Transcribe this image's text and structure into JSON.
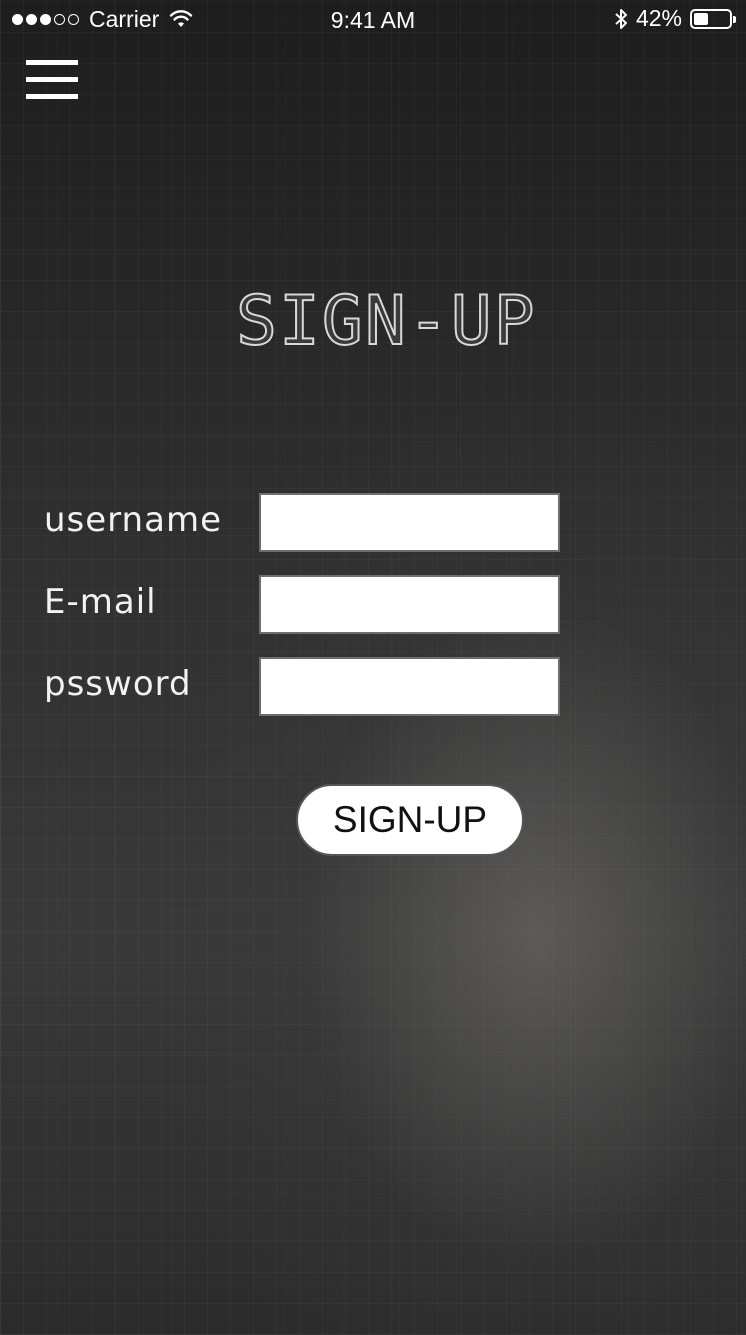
{
  "status_bar": {
    "carrier": "Carrier",
    "time": "9:41 AM",
    "battery_percent_text": "42%",
    "battery_level": 0.42,
    "signal_bars_filled": 3,
    "signal_bars_total": 5
  },
  "header": {
    "menu_icon": "hamburger-menu-icon"
  },
  "main": {
    "title": "SIGN-UP",
    "fields": [
      {
        "label": "username",
        "value": ""
      },
      {
        "label": "E-mail",
        "value": ""
      },
      {
        "label": "pssword",
        "value": ""
      }
    ],
    "submit_label": "SIGN-UP"
  }
}
